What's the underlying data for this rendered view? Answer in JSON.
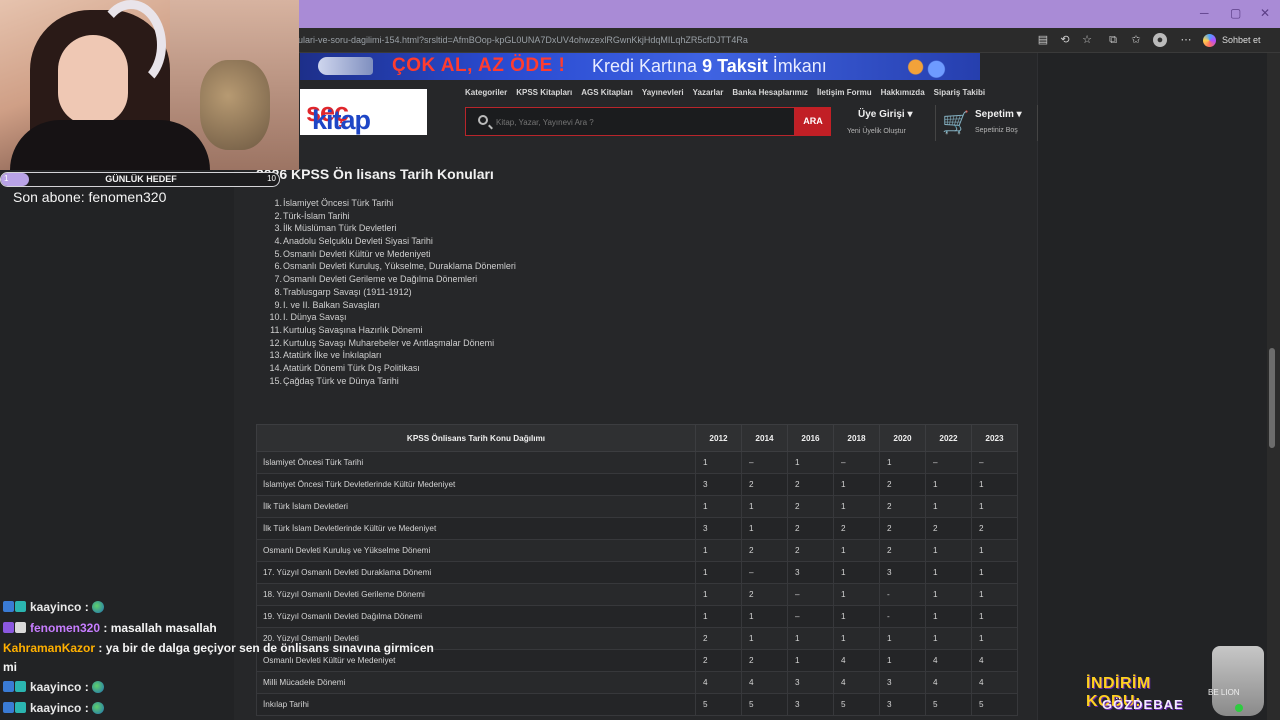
{
  "browser": {
    "url": "ulari-ve-soru-dagilimi-154.html?srsltid=AfmBOop-kpGL0UNA7DxUV4ohwzexlRGwnKkjHdqMILqhZR5cfDJTT4Ra",
    "chat_label": "Sohbet et"
  },
  "banner": {
    "left": "ÇOK AL, AZ ÖDE !",
    "right_pre": "Kredi Kartına ",
    "right_bold": "9 Taksit",
    "right_post": " İmkanı"
  },
  "site": {
    "logo_a": "kitap",
    "logo_b": "seç",
    "nav": [
      "Kategoriler",
      "KPSS Kitapları",
      "AGS Kitapları",
      "Yayınevleri",
      "Yazarlar",
      "Banka Hesaplarımız",
      "İletişim Formu",
      "Hakkımızda",
      "Sipariş Takibi"
    ],
    "search_placeholder": "Kitap, Yazar, Yayınevi Ara ?",
    "search_button": "ARA",
    "login_title": "Üye Girişi",
    "login_sub": "Yeni Üyelik Oluştur",
    "cart_title": "Sepetim",
    "cart_sub": "Sepetiniz Boş"
  },
  "content": {
    "heading": "2026 KPSS Ön lisans Tarih Konuları",
    "topics": [
      "İslamiyet Öncesi Türk Tarihi",
      "Türk-İslam Tarihi",
      "İlk Müslüman Türk Devletleri",
      "Anadolu Selçuklu Devleti Siyasi Tarihi",
      "Osmanlı Devleti Kültür ve Medeniyeti",
      "Osmanlı Devleti Kuruluş, Yükselme, Duraklama Dönemleri",
      "Osmanlı Devleti Gerileme ve Dağılma Dönemleri",
      "Trablusgarp Savaşı (1911-1912)",
      "I. ve II. Balkan Savaşları",
      "I. Dünya Savaşı",
      "Kurtuluş Savaşına Hazırlık Dönemi",
      "Kurtuluş Savaşı Muharebeler ve Antlaşmalar Dönemi",
      "Atatürk İlke ve İnkılapları",
      "Atatürk Dönemi Türk Dış Politikası",
      "Çağdaş Türk ve Dünya Tarihi"
    ],
    "table": {
      "title": "KPSS Önlisans Tarih Konu Dağılımı",
      "years": [
        "2012",
        "2014",
        "2016",
        "2018",
        "2020",
        "2022",
        "2023"
      ],
      "rows": [
        {
          "topic": "İslamiyet Öncesi Türk Tarihi",
          "vals": [
            "1",
            "–",
            "1",
            "–",
            "1",
            "–",
            "–"
          ]
        },
        {
          "topic": "İslamiyet Öncesi Türk Devletlerinde Kültür Medeniyet",
          "vals": [
            "3",
            "2",
            "2",
            "1",
            "2",
            "1",
            "1"
          ]
        },
        {
          "topic": "İlk Türk İslam Devletleri",
          "vals": [
            "1",
            "1",
            "2",
            "1",
            "2",
            "1",
            "1"
          ]
        },
        {
          "topic": "İlk Türk İslam Devletlerinde Kültür ve Medeniyet",
          "vals": [
            "3",
            "1",
            "2",
            "2",
            "2",
            "2",
            "2"
          ]
        },
        {
          "topic": "Osmanlı Devleti Kuruluş ve Yükselme Dönemi",
          "vals": [
            "1",
            "2",
            "2",
            "1",
            "2",
            "1",
            "1"
          ]
        },
        {
          "topic": "17. Yüzyıl Osmanlı Devleti Duraklama Dönemi",
          "vals": [
            "1",
            "–",
            "3",
            "1",
            "3",
            "1",
            "1"
          ]
        },
        {
          "topic": "18. Yüzyıl Osmanlı Devleti Gerileme Dönemi",
          "vals": [
            "1",
            "2",
            "–",
            "1",
            "-",
            "1",
            "1"
          ]
        },
        {
          "topic": "19. Yüzyıl Osmanlı Devleti Dağılma Dönemi",
          "vals": [
            "1",
            "1",
            "–",
            "1",
            "-",
            "1",
            "1"
          ]
        },
        {
          "topic": "20. Yüzyıl Osmanlı Devleti",
          "vals": [
            "2",
            "1",
            "1",
            "1",
            "1",
            "1",
            "1"
          ]
        },
        {
          "topic": "Osmanlı Devleti Kültür ve Medeniyet",
          "vals": [
            "2",
            "2",
            "1",
            "4",
            "1",
            "4",
            "4"
          ]
        },
        {
          "topic": "Milli Mücadele Dönemi",
          "vals": [
            "4",
            "4",
            "3",
            "4",
            "3",
            "4",
            "4"
          ]
        },
        {
          "topic": "İnkılap Tarihi",
          "vals": [
            "5",
            "5",
            "3",
            "5",
            "3",
            "5",
            "5"
          ]
        }
      ]
    }
  },
  "stream": {
    "goal_label": "GÜNLÜK HEDEF",
    "goal_min": "1",
    "goal_max": "10",
    "goal_progress": 0.1,
    "sub_line": "Son abone: fenomen320",
    "chat": [
      {
        "user": "kaayinco",
        "text": "",
        "color": "#e9e9e9",
        "emote": true
      },
      {
        "user": "fenomen320",
        "text": "masallah masallah",
        "color": "#c77dff",
        "emote": false
      },
      {
        "user": "KahramanKazor",
        "text": "ya bir de dalga geçiyor sen de önlisans sınavına girmicen",
        "color": "#ffb000",
        "emote": false
      },
      {
        "user": "",
        "text": "mi",
        "color": "#f5f5f5",
        "emote": false
      },
      {
        "user": "kaayinco",
        "text": "",
        "color": "#e9e9e9",
        "emote": true
      },
      {
        "user": "kaayinco",
        "text": "",
        "color": "#e9e9e9",
        "emote": true
      }
    ],
    "promo_l1": "İNDİRİM KODU:",
    "promo_l2": "GÖZDEBAE",
    "cup_label": "BE LION"
  }
}
